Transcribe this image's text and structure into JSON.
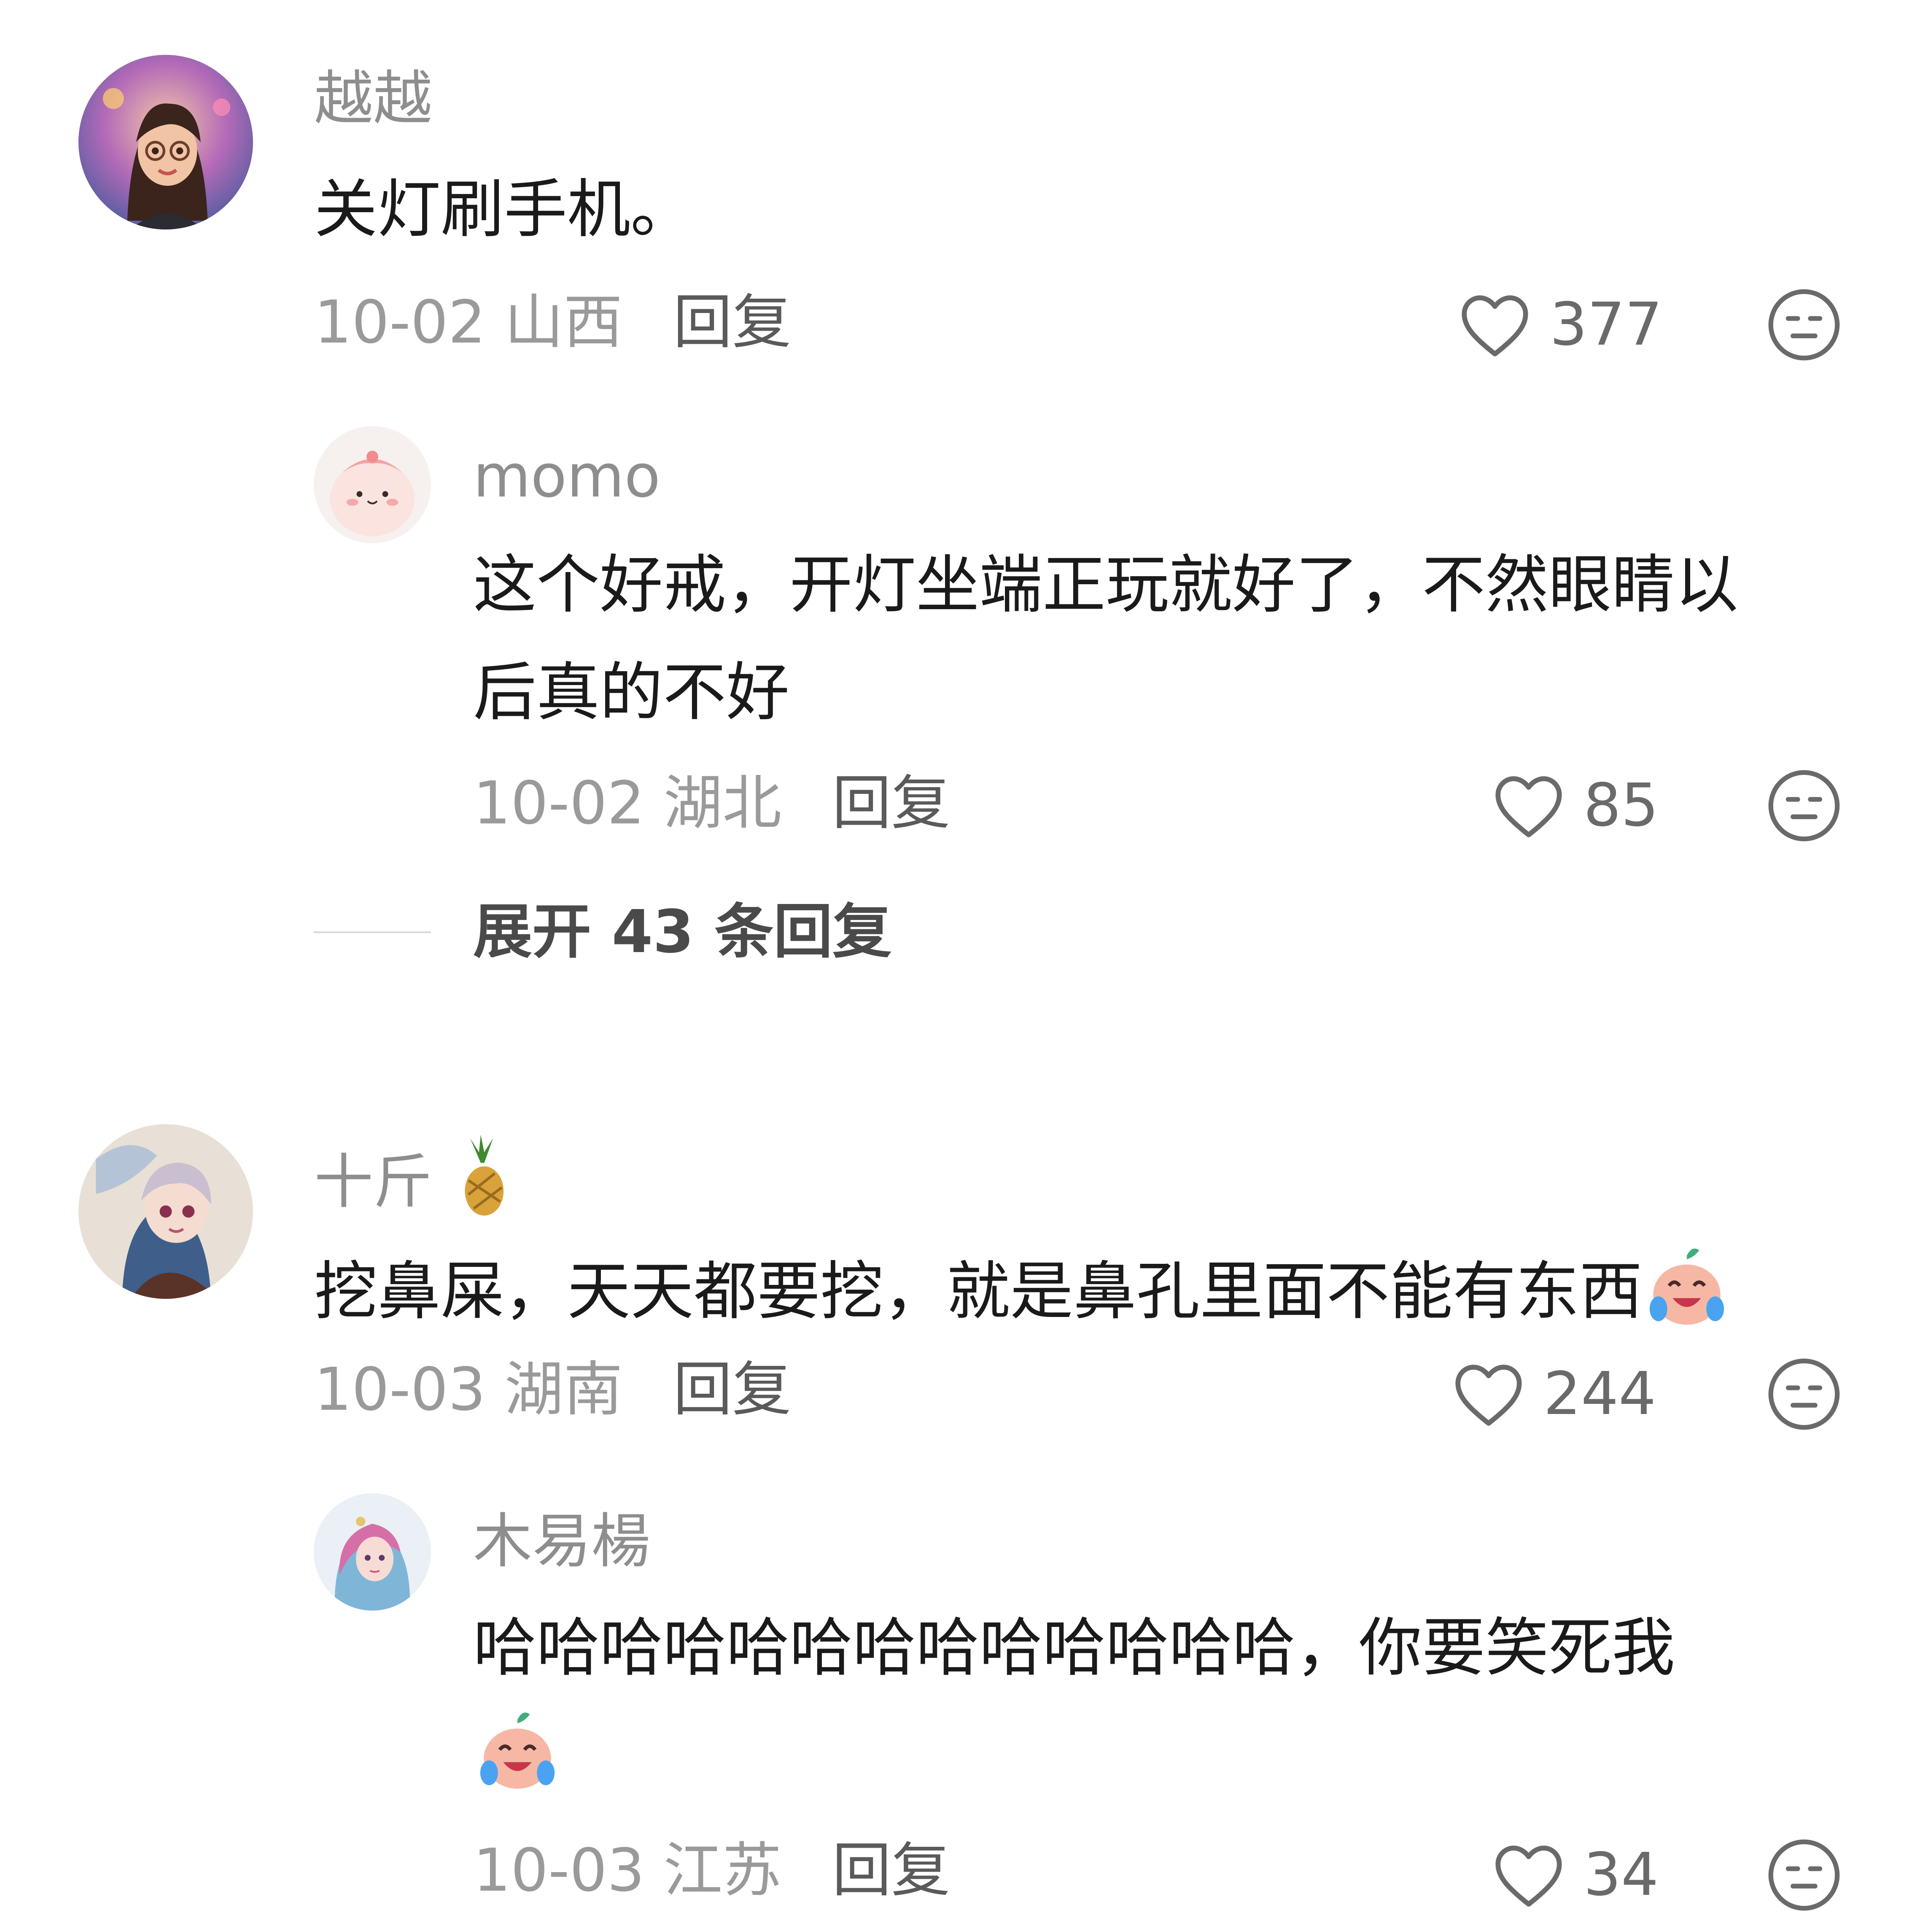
{
  "comments": [
    {
      "username": "越越",
      "text": "关灯刷手机。",
      "date_location": "10-02 山西",
      "reply_label": "回复",
      "likes": "377",
      "avatar_icon": "girl-with-glasses-avatar"
    },
    {
      "username": "momo",
      "text_line1": "这个好戒，开灯坐端正玩就好了，不然眼睛以",
      "text_line2": "后真的不好",
      "date_location": "10-02 湖北",
      "reply_label": "回复",
      "likes": "85",
      "avatar_icon": "pink-blob-avatar"
    },
    {
      "expand_label": "展开 43 条回复"
    },
    {
      "username": "十斤",
      "username_emoji": "pineapple-emoji",
      "text": "挖鼻屎，天天都要挖，就是鼻孔里面不能有东西",
      "text_emoji": "crying-laughing-peach-emoji",
      "date_location": "10-03 湖南",
      "reply_label": "回复",
      "likes": "244",
      "avatar_icon": "anime-girl-avatar"
    },
    {
      "username": "木易楊",
      "text_line1": "哈哈哈哈哈哈哈哈哈哈哈哈哈，你要笑死我",
      "text_emoji": "crying-laughing-peach-emoji",
      "date_location": "10-03 江苏",
      "reply_label": "回复",
      "likes": "34",
      "avatar_icon": "anime-woman-avatar"
    }
  ],
  "colors": {
    "username": "#8e8e8e",
    "content": "#1a1a1a",
    "meta": "#9a9a9a",
    "reply": "#5a5a5a"
  }
}
